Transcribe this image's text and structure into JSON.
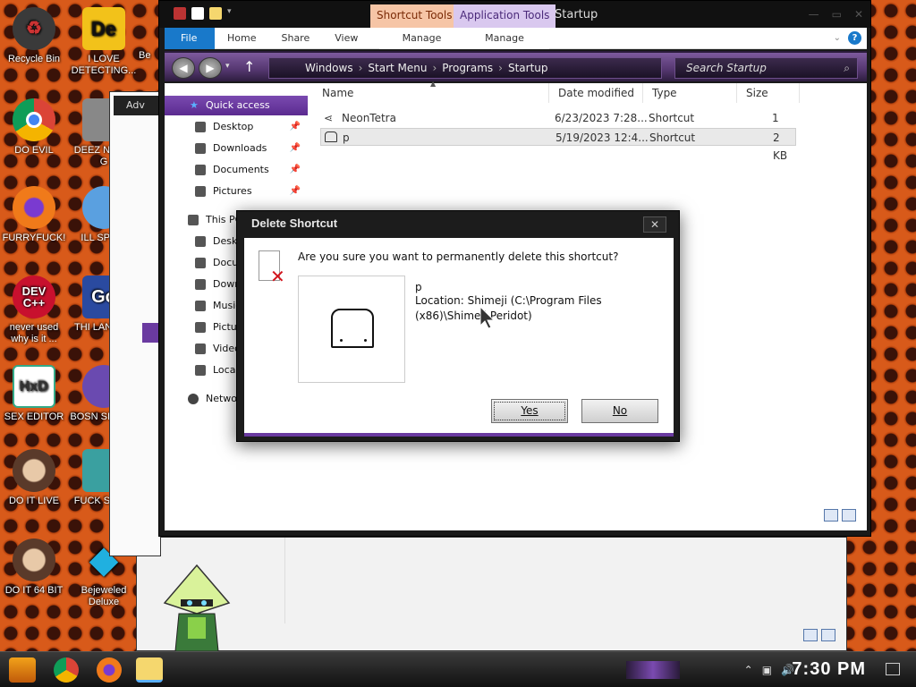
{
  "desktop": {
    "icons_col1": [
      {
        "label": "Recycle Bin",
        "icon": "recycle-bin-icon",
        "color": "#444444"
      },
      {
        "label": "DO EVIL",
        "icon": "chrome-icon",
        "color": "#2f8bd6"
      },
      {
        "label": "FURRYFUCK!",
        "icon": "firefox-icon",
        "color": "#f07a1a"
      },
      {
        "label": "never used why is it ...",
        "icon": "devcpp-icon",
        "color": "#c8102e"
      },
      {
        "label": "SEX EDITOR",
        "icon": "hxd-icon",
        "color": "#ffffff"
      },
      {
        "label": "DO IT LIVE",
        "icon": "portrait-icon",
        "color": "#7a5a44"
      },
      {
        "label": "DO IT 64 BIT",
        "icon": "portrait-icon",
        "color": "#7a5a44"
      }
    ],
    "icons_col2": [
      {
        "label": "I LOVE DETECTING...",
        "icon": "de-icon",
        "color": "#f2c21a"
      },
      {
        "label": "DEEZ N HAH G",
        "icon": "app-icon",
        "color": "#999999"
      },
      {
        "label": "ILL SP YO",
        "icon": "app-icon",
        "color": "#5aa0e0"
      },
      {
        "label": "THI LANGUA",
        "icon": "app-icon",
        "color": "#2a4aa0"
      },
      {
        "label": "BOSN SIMULA",
        "icon": "app-icon",
        "color": "#6a4ab0"
      },
      {
        "label": "FUCK S ELVI",
        "icon": "app-icon",
        "color": "#3aa0a0"
      },
      {
        "label": "Bejeweled Deluxe",
        "icon": "gem-icon",
        "color": "#20b0e0"
      }
    ],
    "partial_icon_label": "Be"
  },
  "explorer": {
    "title": "Startup",
    "context_tabs": {
      "shortcut_tools": "Shortcut Tools",
      "application_tools": "Application Tools"
    },
    "ribbon_tabs": [
      "File",
      "Home",
      "Share",
      "View"
    ],
    "manage_1": "Manage",
    "manage_2": "Manage",
    "help": "?",
    "breadcrumb": [
      "Windows",
      "Start Menu",
      "Programs",
      "Startup"
    ],
    "search_placeholder": "Search Startup",
    "nav": {
      "quick_access": "Quick access",
      "pinned": [
        {
          "label": "Desktop"
        },
        {
          "label": "Downloads"
        },
        {
          "label": "Documents"
        },
        {
          "label": "Pictures"
        }
      ],
      "this_pc": "This PC",
      "this_pc_items": [
        "Deskt",
        "Docu",
        "Down",
        "Music",
        "Pictu",
        "Video",
        "Local"
      ],
      "network": "Netwo"
    },
    "columns": {
      "name": "Name",
      "date_modified": "Date modified",
      "type": "Type",
      "size": "Size"
    },
    "files": [
      {
        "name": "NeonTetra",
        "date": "6/23/2023 7:28...",
        "type": "Shortcut",
        "size": "1 KB"
      },
      {
        "name": "p",
        "date": "5/19/2023 12:4...",
        "type": "Shortcut",
        "size": "2 KB"
      }
    ]
  },
  "background_window": {
    "title_fragment": "Adv"
  },
  "dialog": {
    "title": "Delete Shortcut",
    "close": "✕",
    "question": "Are you sure you want to permanently delete this shortcut?",
    "file_name": "p",
    "location_line1": "Location: Shimeji (C:\\Program Files",
    "location_line2": "(x86)\\Shimeji Peridot)",
    "yes": "Yes",
    "no": "No"
  },
  "taskbar": {
    "clock": "7:30 PM"
  },
  "colors": {
    "accent_purple": "#6a3aa0",
    "file_tab_blue": "#1979ca"
  }
}
